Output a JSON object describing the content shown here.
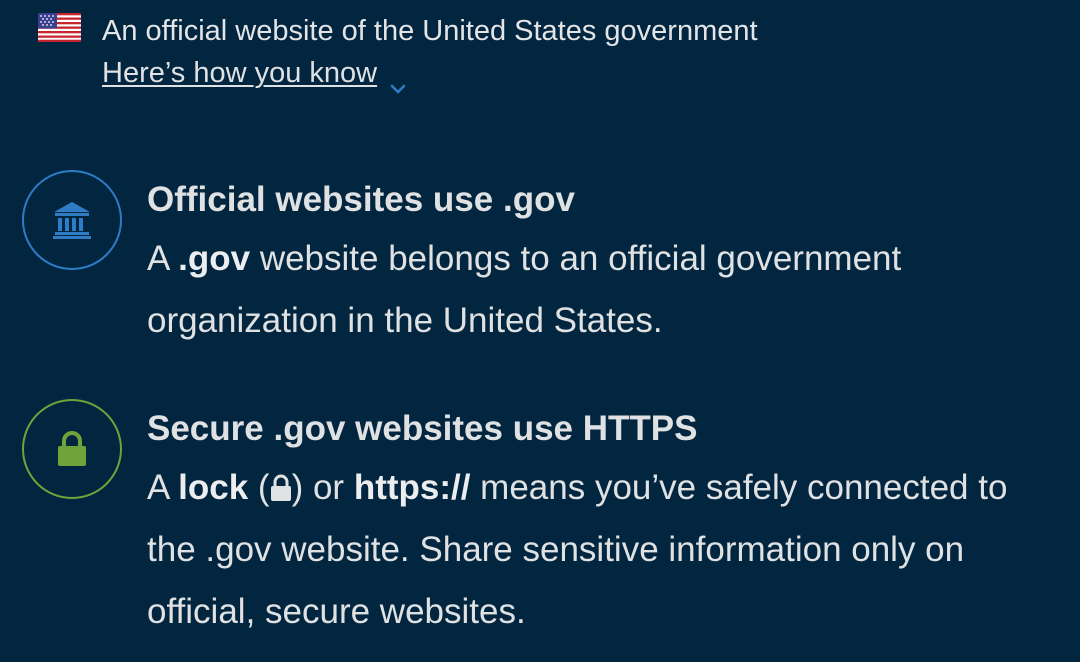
{
  "banner": {
    "official_text": "An official website of the United States government",
    "how_link": "Here’s how you know",
    "flag_icon": "us-flag-icon",
    "chevron_icon": "chevron-down-icon"
  },
  "guidance": {
    "gov": {
      "icon": "government-building-icon",
      "title": "Official websites use .gov",
      "body_prefix": "A ",
      "body_bold": ".gov",
      "body_suffix": " website belongs to an official government organization in the United States."
    },
    "https": {
      "icon": "lock-icon",
      "title": "Secure .gov websites use HTTPS",
      "body_a": "A ",
      "body_lock_word": "lock",
      "body_paren_open": " (",
      "body_paren_close": ")",
      "body_or": " or ",
      "body_https": "https://",
      "body_rest": " means you’ve safely connected to the .gov website. Share sensitive information only on official, secure websites."
    }
  },
  "colors": {
    "background": "#032640",
    "text": "#dfe1e2",
    "gov_icon": "#2e7bc6",
    "lock_icon": "#70a33a"
  }
}
